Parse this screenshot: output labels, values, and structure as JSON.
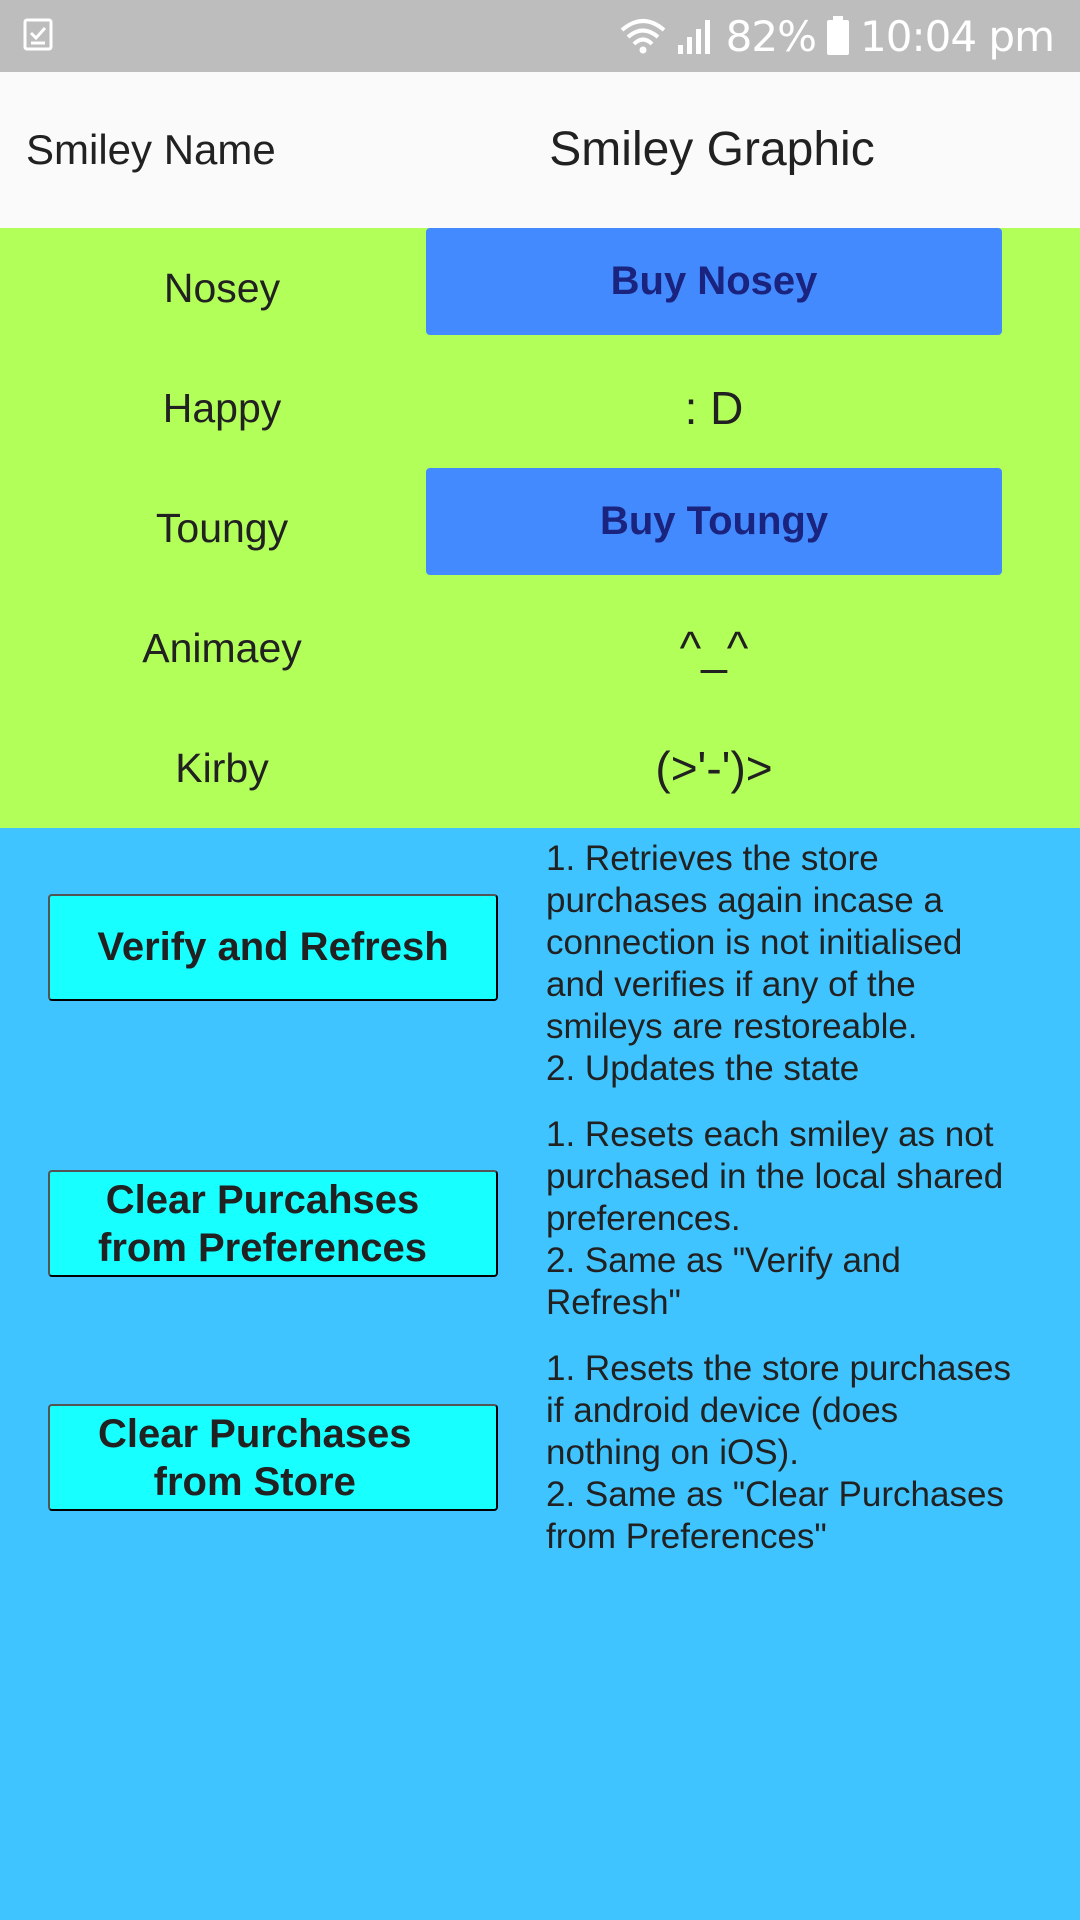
{
  "status_bar": {
    "battery": "82%",
    "time": "10:04 pm",
    "icons": [
      "clipboard-check-icon",
      "wifi-icon",
      "signal-icon",
      "battery-icon"
    ]
  },
  "header": {
    "name_label": "Smiley Name",
    "graphic_label": "Smiley Graphic"
  },
  "smileys": [
    {
      "name": "Nosey",
      "button": "Buy Nosey"
    },
    {
      "name": "Happy",
      "graphic": ": D"
    },
    {
      "name": "Toungy",
      "button": "Buy Toungy"
    },
    {
      "name": "Animaey",
      "graphic": "^_^"
    },
    {
      "name": "Kirby",
      "graphic": "(>'-')>"
    }
  ],
  "actions": [
    {
      "button": "Verify and Refresh",
      "description": [
        "1. Retrieves the store",
        "purchases again incase a",
        "connection is not initialised",
        "and verifies if any of the",
        "smileys are restoreable.",
        "2. Updates the state"
      ]
    },
    {
      "button_lines": [
        "Clear Purcahses",
        "from Preferences"
      ],
      "description": [
        "1. Resets each smiley as not",
        "purchased in the local shared",
        "preferences.",
        "2. Same as \"Verify and",
        "Refresh\""
      ]
    },
    {
      "button_lines": [
        "Clear Purchases",
        "from Store"
      ],
      "description": [
        "1. Resets the store purchases",
        "if android device (does",
        "nothing on iOS).",
        "2. Same as \"Clear Purchases",
        "from Preferences\""
      ]
    }
  ],
  "colors": {
    "status_bar": "#bdbdbd",
    "header": "#fafafa",
    "table_background": "#b2ff59",
    "buy_button": "#448aff",
    "buy_button_text": "#1a237e",
    "page_background": "#40c4ff",
    "action_button": "#18ffff"
  }
}
